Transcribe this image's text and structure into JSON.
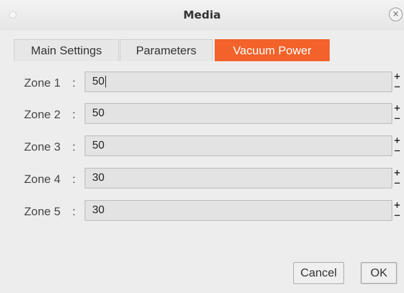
{
  "window": {
    "title": "Media",
    "close_glyph": "×"
  },
  "tabs": [
    {
      "label": "Main Settings",
      "active": false
    },
    {
      "label": "Parameters",
      "active": false
    },
    {
      "label": "Vacuum Power",
      "active": true
    }
  ],
  "accent_color": "#f2622a",
  "zones": [
    {
      "label": "Zone 1",
      "colon": ":",
      "value": "50"
    },
    {
      "label": "Zone 2",
      "colon": ":",
      "value": "50"
    },
    {
      "label": "Zone 3",
      "colon": ":",
      "value": "50"
    },
    {
      "label": "Zone 4",
      "colon": ":",
      "value": "30"
    },
    {
      "label": "Zone 5",
      "colon": ":",
      "value": "30"
    }
  ],
  "stepper": {
    "plus": "+",
    "minus": "−"
  },
  "buttons": {
    "cancel": "Cancel",
    "ok": "OK"
  }
}
